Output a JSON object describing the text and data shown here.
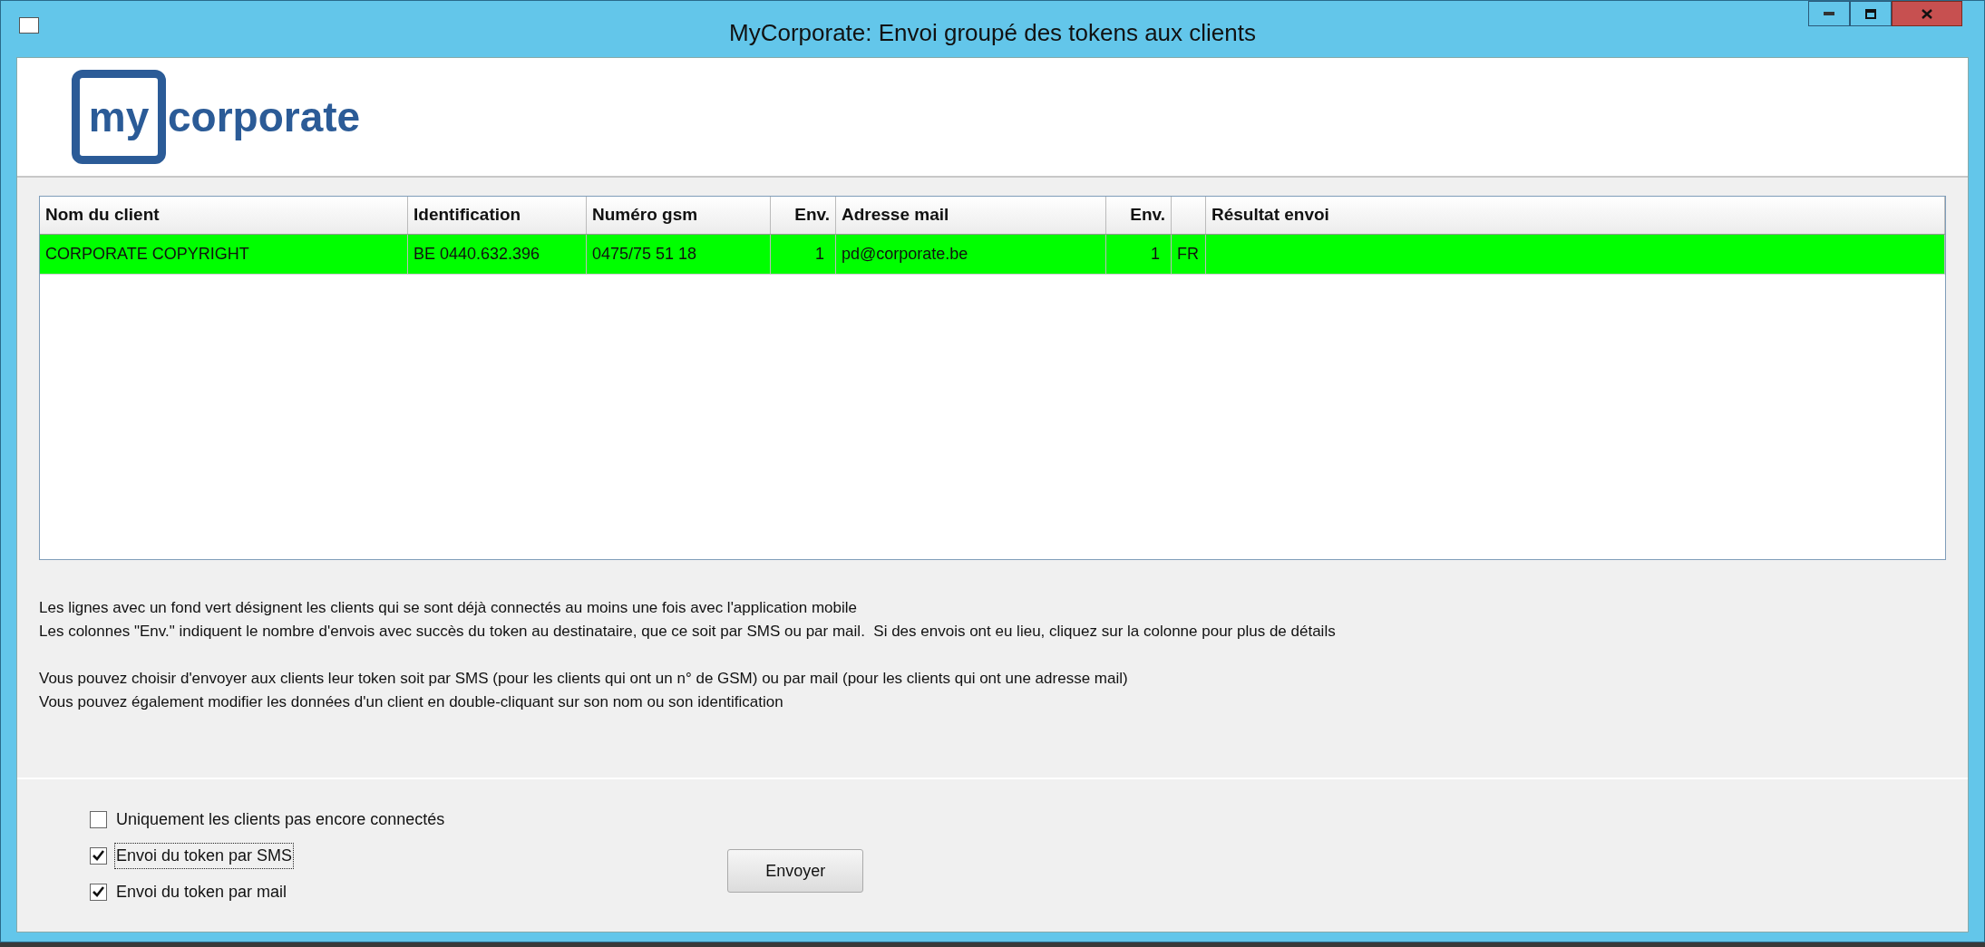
{
  "window": {
    "title": "MyCorporate: Envoi groupé des tokens aux clients"
  },
  "logo": {
    "part_1": "my",
    "part_2": "corporate"
  },
  "table": {
    "columns": [
      "Nom du client",
      "Identification",
      "Numéro gsm",
      "Env.",
      "Adresse mail",
      "Env.",
      null,
      "Résultat envoi"
    ],
    "rows": [
      {
        "connected": true,
        "cells": [
          "CORPORATE COPYRIGHT",
          "BE 0440.632.396",
          "0475/75 51 18",
          "1",
          "pd@corporate.be",
          "1",
          "FR",
          null
        ]
      }
    ]
  },
  "notes": [
    [
      "Les lignes avec un fond vert désignent les clients qui se sont déjà connectés au moins une fois avec l'application mobile",
      "Les colonnes \"Env.\" indiquent le nombre d'envois avec succès du token au destinataire, que ce soit par SMS ou par mail.  Si des envois ont eu lieu, cliquez sur la colonne pour plus de détails"
    ],
    [
      "Vous pouvez choisir d'envoyer aux clients leur token soit par SMS (pour les clients qui ont un n° de GSM) ou par mail (pour les clients qui ont une adresse mail)",
      "Vous pouvez également modifier les données d'un client en double-cliquant sur son nom ou son identification"
    ]
  ],
  "options": [
    {
      "label": "Uniquement les clients pas encore connectés",
      "checked": false,
      "focused": false
    },
    {
      "label": "Envoi du token par SMS",
      "checked": true,
      "focused": true
    },
    {
      "label": "Envoi du token par mail",
      "checked": true,
      "focused": false
    }
  ],
  "send_button": "Envoyer"
}
